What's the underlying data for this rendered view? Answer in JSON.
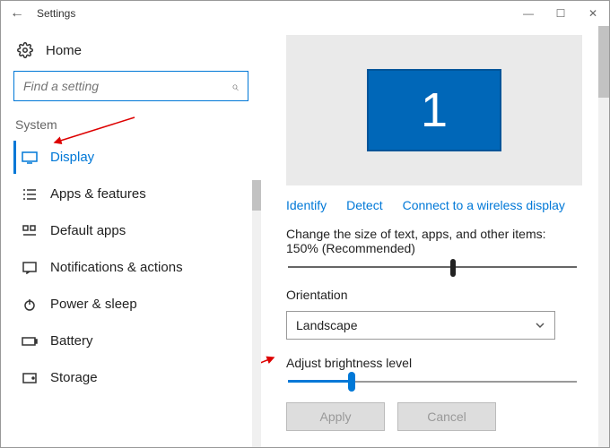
{
  "window": {
    "title": "Settings",
    "controls": {
      "min": "—",
      "max": "☐",
      "close": "✕"
    }
  },
  "sidebar": {
    "home": "Home",
    "search_placeholder": "Find a setting",
    "section": "System",
    "items": [
      {
        "label": "Display",
        "icon": "display",
        "active": true
      },
      {
        "label": "Apps & features",
        "icon": "list"
      },
      {
        "label": "Default apps",
        "icon": "defaults"
      },
      {
        "label": "Notifications & actions",
        "icon": "notify"
      },
      {
        "label": "Power & sleep",
        "icon": "power"
      },
      {
        "label": "Battery",
        "icon": "battery"
      },
      {
        "label": "Storage",
        "icon": "storage"
      }
    ]
  },
  "main": {
    "monitor_label": "1",
    "links": {
      "identify": "Identify",
      "detect": "Detect",
      "connect": "Connect to a wireless display"
    },
    "scale_label": "Change the size of text, apps, and other items: 150% (Recommended)",
    "scale_pct": 57,
    "orientation_label": "Orientation",
    "orientation_value": "Landscape",
    "brightness_label": "Adjust brightness level",
    "brightness_pct": 22,
    "apply": "Apply",
    "cancel": "Cancel"
  }
}
